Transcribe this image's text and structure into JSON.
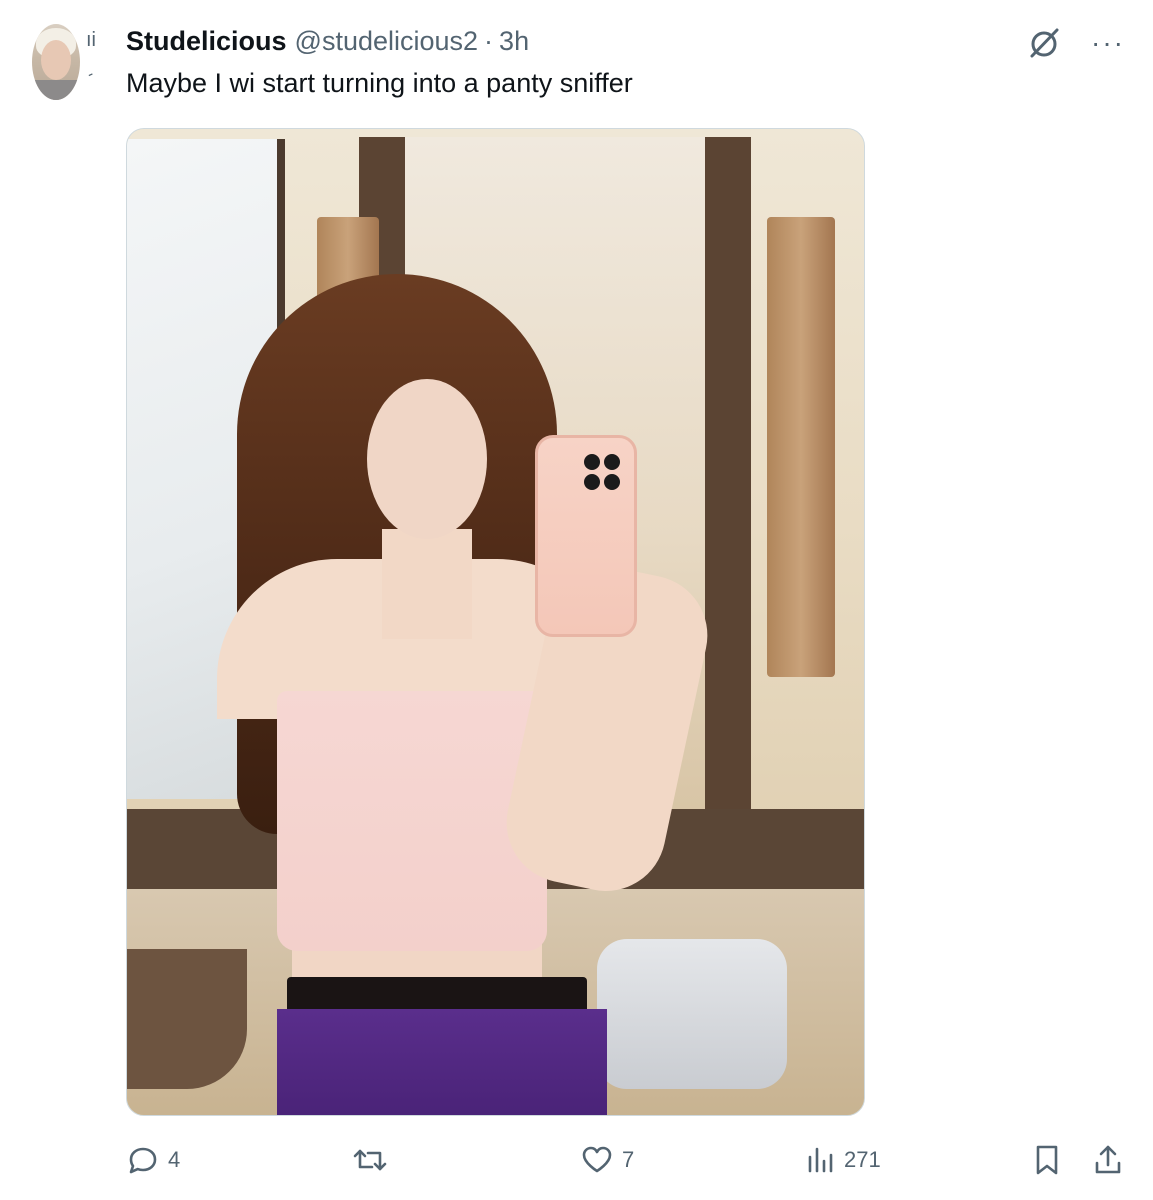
{
  "tweet": {
    "display_name": "Studelicious",
    "handle": "@studelicious2",
    "separator": "·",
    "time": "3h",
    "text": "Maybe I wi start turning into a panty sniffer",
    "side_marks": "ıi"
  },
  "icons": {
    "grok": "grok-icon",
    "more": "more-icon",
    "reply": "reply-icon",
    "retweet": "retweet-icon",
    "like": "like-icon",
    "views": "views-icon",
    "bookmark": "bookmark-icon",
    "share": "share-icon"
  },
  "more_label": "···",
  "stats": {
    "replies": "4",
    "retweets": "",
    "likes": "7",
    "views": "271"
  },
  "colors": {
    "text_primary": "#0f1419",
    "text_secondary": "#536471",
    "border": "#cfd9de"
  }
}
